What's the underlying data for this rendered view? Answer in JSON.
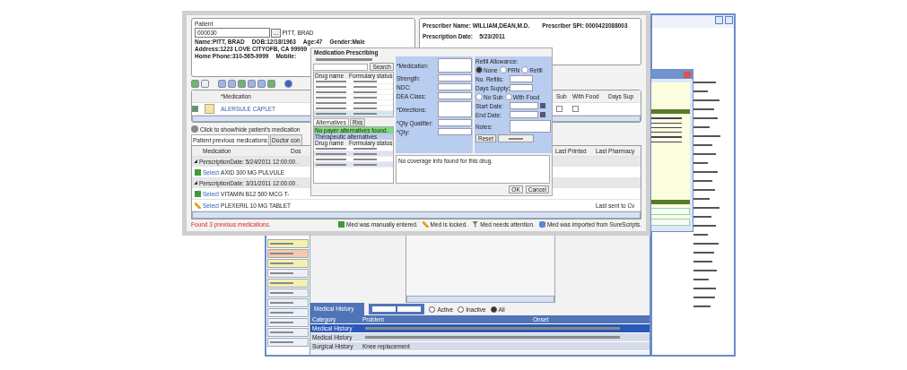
{
  "patient": {
    "title": "Patient",
    "id_value": "000030",
    "lookup_label": "...",
    "display_name": "PITT, BRAD",
    "row1": [
      {
        "label": "Name:",
        "value": "PITT, BRAD"
      },
      {
        "label": "DOB:",
        "value": "12/18/1963"
      },
      {
        "label": "Age:",
        "value": "47"
      },
      {
        "label": "Gender:",
        "value": "Male"
      }
    ],
    "row2": [
      {
        "label": "Address:",
        "value": "1223 LOVE CITYOFB, CA 99999"
      }
    ],
    "row3": [
      {
        "label": "Home Phone:",
        "value": "310-565-9999"
      },
      {
        "label": "Mobile:"
      }
    ]
  },
  "prescriber": {
    "name_label": "Prescriber Name:",
    "name": "WILLIAM,DEAN,M.D.",
    "spi_label": "Prescriber SPI:",
    "spi": "0000423088003",
    "date_label": "Prescription Date:",
    "date": "5/23/2011"
  },
  "current_meds": {
    "columns": [
      "*Medication",
      "Sub",
      "With Food",
      "Days Sup"
    ],
    "rows": [
      {
        "checked": true,
        "medication": "ALERSULE CAPLET",
        "sub": false,
        "with_food": false
      }
    ]
  },
  "toggle_label": "Click to show/hide patient's medication",
  "tabs": [
    {
      "label": "Patient previous medications",
      "selected": true
    },
    {
      "label": "Doctor con",
      "selected": false
    }
  ],
  "previous_meds": {
    "columns": [
      "Medication",
      "Dos",
      "Last Printed",
      "Last Pharmacy"
    ],
    "items": [
      {
        "kind": "group",
        "label": "PerscriptionDate: 5/24/2011 12:00:00 ."
      },
      {
        "kind": "manual",
        "link": "Select",
        "medication": "AXID 300 MG PULVULE"
      },
      {
        "kind": "group",
        "label": "PerscriptionDate: 3/31/2011 12:00:00 ."
      },
      {
        "kind": "manual",
        "link": "Select",
        "medication": "VITAMIN B12 500 MCG T-"
      },
      {
        "kind": "locked",
        "link": "Select",
        "medication": "PLEXERIL 10 MG TABLET",
        "last_pharmacy": "Last sent to Cv"
      }
    ]
  },
  "status": "Found 3 previous medications.",
  "legend": [
    {
      "kind": "manual",
      "label": "Med was manually entered."
    },
    {
      "kind": "locked",
      "label": "Med is locked."
    },
    {
      "kind": "attention",
      "label": "Med needs attention."
    },
    {
      "kind": "imported",
      "label": "Med was imported from SureScripts."
    }
  ],
  "dialog": {
    "title": "Medication Prescribing",
    "search_button": "Search",
    "list_columns": [
      "Drug name",
      "Formulary status"
    ],
    "tabs": [
      {
        "label": "Alternatives",
        "selected": true
      },
      {
        "label": "Rxs",
        "selected": false
      }
    ],
    "payer_note": "No payer alternatives found.",
    "therapeutic_note": "Therapeutic alternatives",
    "alt_columns": [
      "Drug name",
      "Formulary status"
    ],
    "form_labels": [
      "*Medication:",
      "Strength:",
      "NDC:",
      "DEA Class:",
      "*Directions:",
      "*Qty Qualifier:",
      "*Qty:"
    ],
    "refill_label": "Refill Allowance:",
    "refill_options": [
      {
        "label": "None",
        "selected": true
      },
      {
        "label": "PRN",
        "selected": false
      },
      {
        "label": "Refill",
        "selected": false
      }
    ],
    "right_labels": [
      "No. Refills:",
      "Days Supply:"
    ],
    "flags": [
      {
        "label": "No Sub",
        "checked": false
      },
      {
        "label": "With Food",
        "checked": false
      }
    ],
    "date_labels": [
      "Start Date:",
      "End Date:",
      "Notes:"
    ],
    "action_buttons": [
      "Reset"
    ],
    "coverage_note": "No coverage info found for this drug.",
    "footer_buttons": [
      "OK",
      "Cancel"
    ]
  },
  "history": {
    "title": "Medical History",
    "filters": [
      {
        "label": "Active",
        "selected": false
      },
      {
        "label": "Inactive",
        "selected": false
      },
      {
        "label": "All",
        "selected": true
      }
    ],
    "columns": [
      "Category",
      "Problem",
      "Onset"
    ],
    "rows": [
      {
        "category": "Medical History",
        "selected": true
      },
      {
        "category": "Medical History",
        "selected": false
      },
      {
        "category": "Surgical History",
        "problem": "Knee replacement",
        "selected": false
      }
    ]
  }
}
